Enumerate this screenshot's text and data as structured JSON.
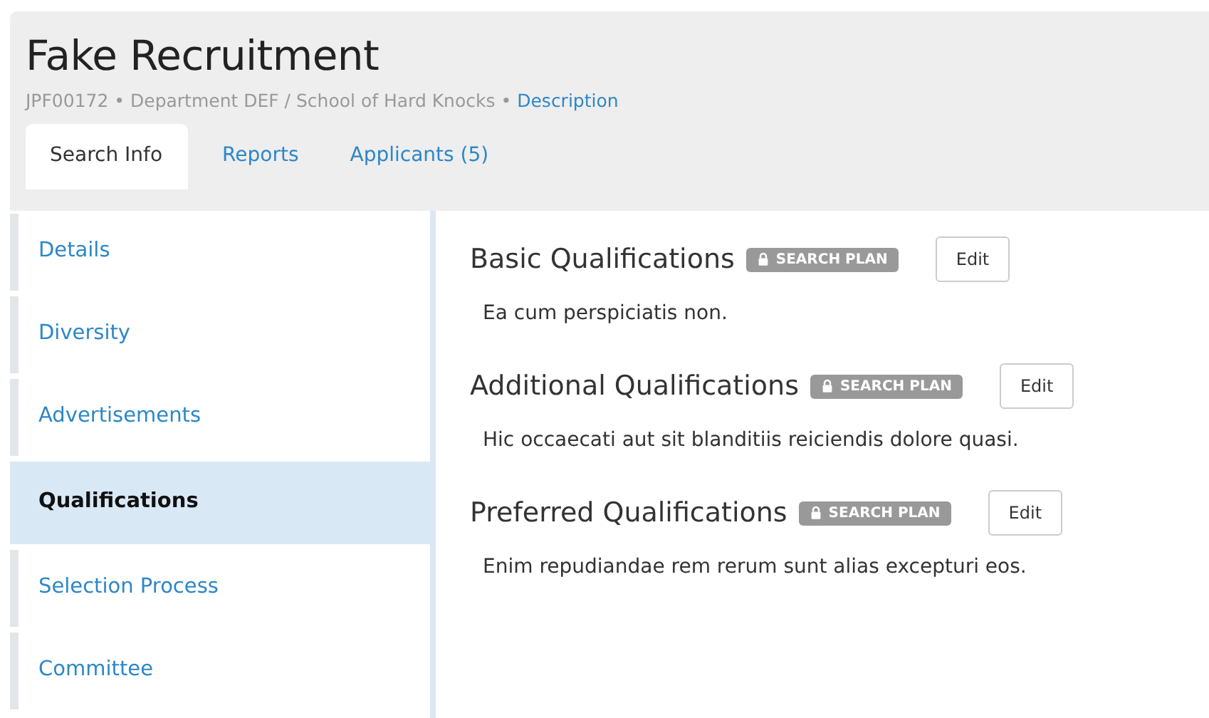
{
  "header": {
    "title": "Fake Recruitment",
    "subtitle": "JPF00172 • Department DEF / School of Hard Knocks •",
    "link": "Description"
  },
  "tabs": [
    {
      "label": "Search Info",
      "selected": true
    },
    {
      "label": "Reports",
      "selected": false
    },
    {
      "label": "Applicants (5)",
      "selected": false
    }
  ],
  "sidebar": {
    "items": [
      {
        "label": "Details",
        "selected": false
      },
      {
        "label": "Diversity",
        "selected": false
      },
      {
        "label": "Advertisements",
        "selected": false
      },
      {
        "label": "Qualifications",
        "selected": true
      },
      {
        "label": "Selection Process",
        "selected": false
      },
      {
        "label": "Committee",
        "selected": false
      }
    ]
  },
  "sections": [
    {
      "heading": "Basic Qualifications",
      "badge": "SEARCH PLAN",
      "button": "Edit",
      "text": "Ea cum perspiciatis non."
    },
    {
      "heading": "Additional Qualifications",
      "badge": "SEARCH PLAN",
      "button": "Edit",
      "text": "Hic occaecati aut sit blanditiis reiciendis dolore quasi."
    },
    {
      "heading": "Preferred Qualifications",
      "badge": "SEARCH PLAN",
      "button": "Edit",
      "text": "Enim repudiandae rem rerum sunt alias excepturi eos."
    }
  ]
}
